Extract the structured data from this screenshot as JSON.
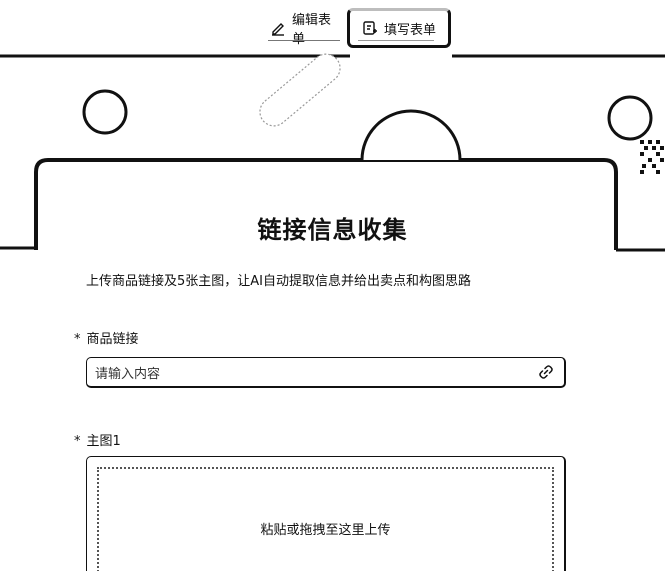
{
  "tabs": {
    "edit_label": "编辑表单",
    "fill_label": "填写表单"
  },
  "form": {
    "title": "链接信息收集",
    "description": "上传商品链接及5张主图，让AI自动提取信息并给出卖点和构图思路",
    "fields": [
      {
        "label": "商品链接",
        "required_mark": "*",
        "placeholder": "请输入内容"
      },
      {
        "label": "主图1",
        "required_mark": "*",
        "upload_hint": "粘贴或拖拽至这里上传"
      }
    ]
  }
}
